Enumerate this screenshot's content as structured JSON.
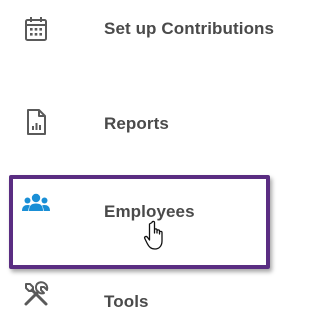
{
  "menu": {
    "items": [
      {
        "label": "Set up Contributions",
        "icon": "calendar-icon"
      },
      {
        "label": "Reports",
        "icon": "report-document-icon"
      },
      {
        "label": "Employees",
        "icon": "people-group-icon"
      },
      {
        "label": "Tools",
        "icon": "tools-icon"
      }
    ]
  },
  "colors": {
    "icon_gray": "#5a5a5a",
    "employees_blue": "#1a8fd6",
    "highlight_purple": "#5a2d82",
    "label_text": "#4a4a4a"
  },
  "cursor": {
    "icon": "hand-pointer-cursor-icon"
  }
}
